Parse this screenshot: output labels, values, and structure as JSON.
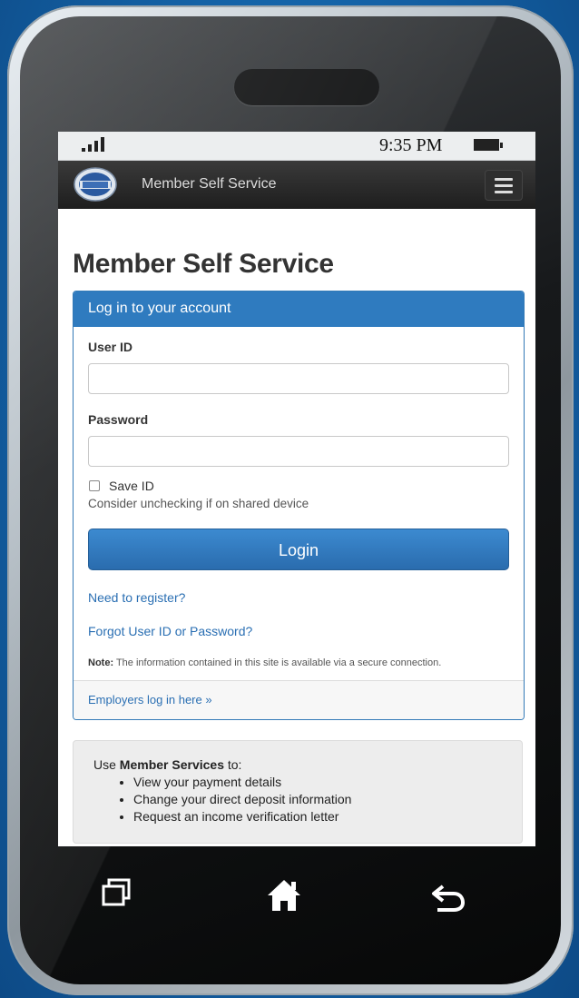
{
  "status_bar": {
    "time": "9:35 PM"
  },
  "app_bar": {
    "title": "Member Self Service"
  },
  "page": {
    "title": "Member Self Service"
  },
  "login_panel": {
    "heading": "Log in to your account",
    "user_id_label": "User ID",
    "user_id_value": "",
    "password_label": "Password",
    "password_value": "",
    "save_id_label": "Save ID",
    "save_id_hint": "Consider unchecking if on shared device",
    "login_button": "Login",
    "register_link": "Need to register?",
    "forgot_link": "Forgot User ID or Password?",
    "note_label": "Note:",
    "note_text": " The information contained in this site is available via a secure connection.",
    "employers_link": "Employers log in here »"
  },
  "member_services": {
    "intro_prefix": "Use ",
    "intro_bold": "Member Services",
    "intro_suffix": " to:",
    "items": [
      "View your payment details",
      "Change your direct deposit information",
      "Request an income verification letter"
    ]
  },
  "icons": {
    "signal": "signal-icon",
    "battery": "battery-icon",
    "logo": "logo-icon",
    "menu": "hamburger-menu-icon",
    "recent": "recent-apps-icon",
    "home": "home-icon",
    "back": "back-icon"
  },
  "colors": {
    "panel_heading": "#2f7bbf",
    "login_button": "#3c8ad0",
    "link": "#2a6fb3",
    "app_bar": "#2a2a2a",
    "background": "#1565aa"
  }
}
